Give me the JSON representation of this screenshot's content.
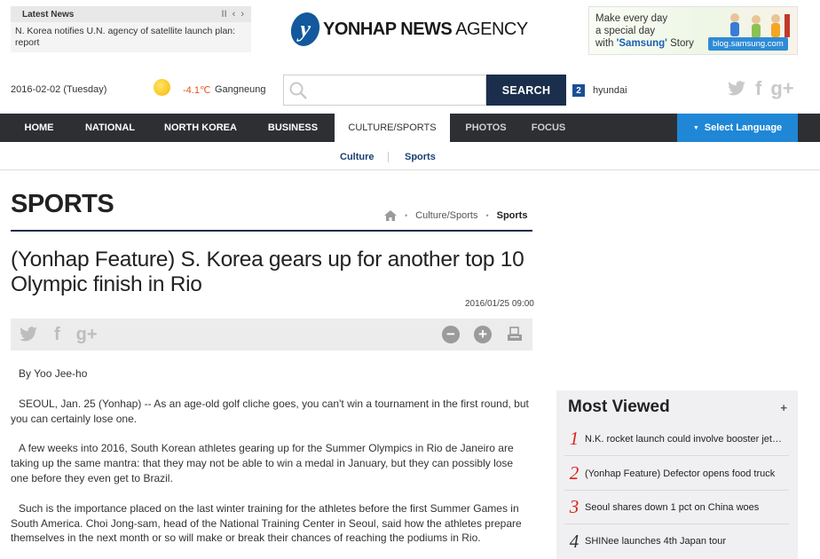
{
  "latest_news": {
    "title": "Latest News",
    "controls": [
      "II",
      "‹",
      "›"
    ],
    "headline": "N. Korea notifies U.N. agency of satellite launch plan: report"
  },
  "logo": {
    "mark": "y",
    "bold": "YONHAP NEWS",
    "light": " AGENCY"
  },
  "ad": {
    "line1": "Make every day",
    "line2": "a special day",
    "line3_prefix": "with ",
    "brand": "'Samsung'",
    "line3_suffix": " Story",
    "url": "blog.samsung.com"
  },
  "info": {
    "date": "2016-02-02 (Tuesday)",
    "temperature": "-4.1℃",
    "city": "Gangneung",
    "search_placeholder": "",
    "search_button": "SEARCH",
    "rank_number": "2",
    "rank_keyword": "hyundai"
  },
  "social": {
    "twitter": "t",
    "facebook": "f",
    "gplus": "g+"
  },
  "nav": {
    "items": [
      "HOME",
      "NATIONAL",
      "NORTH KOREA",
      "BUSINESS",
      "CULTURE/SPORTS",
      "PHOTOS",
      "FOCUS"
    ],
    "language": "Select Language"
  },
  "subnav": {
    "items": [
      "Culture",
      "Sports"
    ]
  },
  "section": {
    "title": "SPORTS",
    "breadcrumb": [
      "Culture/Sports",
      "Sports"
    ]
  },
  "article": {
    "headline": "(Yonhap Feature) S. Korea gears up for another top 10 Olympic finish in Rio",
    "timestamp": "2016/01/25 09:00",
    "toolbar": {
      "minus": "−",
      "plus": "+"
    },
    "byline": "By Yoo Jee-ho",
    "paragraphs": [
      "SEOUL, Jan. 25 (Yonhap) -- As an age-old golf cliche goes, you can't win a tournament in the first round, but you can certainly lose one.",
      "A few weeks into 2016, South Korean athletes gearing up for the Summer Olympics in Rio de Janeiro are taking up the same mantra: that they may not be able to win a medal in January, but they can possibly lose one before they even get to Brazil.",
      "Such is the importance placed on the last winter training for the athletes before the first Summer Games in South America. Choi Jong-sam, head of the National Training Center in Seoul, said how the athletes prepare themselves in the next month or so will make or break their chances of reaching the podiums in Rio."
    ]
  },
  "most_viewed": {
    "title": "Most Viewed",
    "more": "+",
    "items": [
      {
        "rank": "1",
        "text": "N.K. rocket launch could involve booster jettison"
      },
      {
        "rank": "2",
        "text": "(Yonhap Feature) Defector opens food truck"
      },
      {
        "rank": "3",
        "text": "Seoul shares down 1 pct on China woes"
      },
      {
        "rank": "4",
        "text": "SHINee launches 4th Japan tour"
      }
    ]
  }
}
